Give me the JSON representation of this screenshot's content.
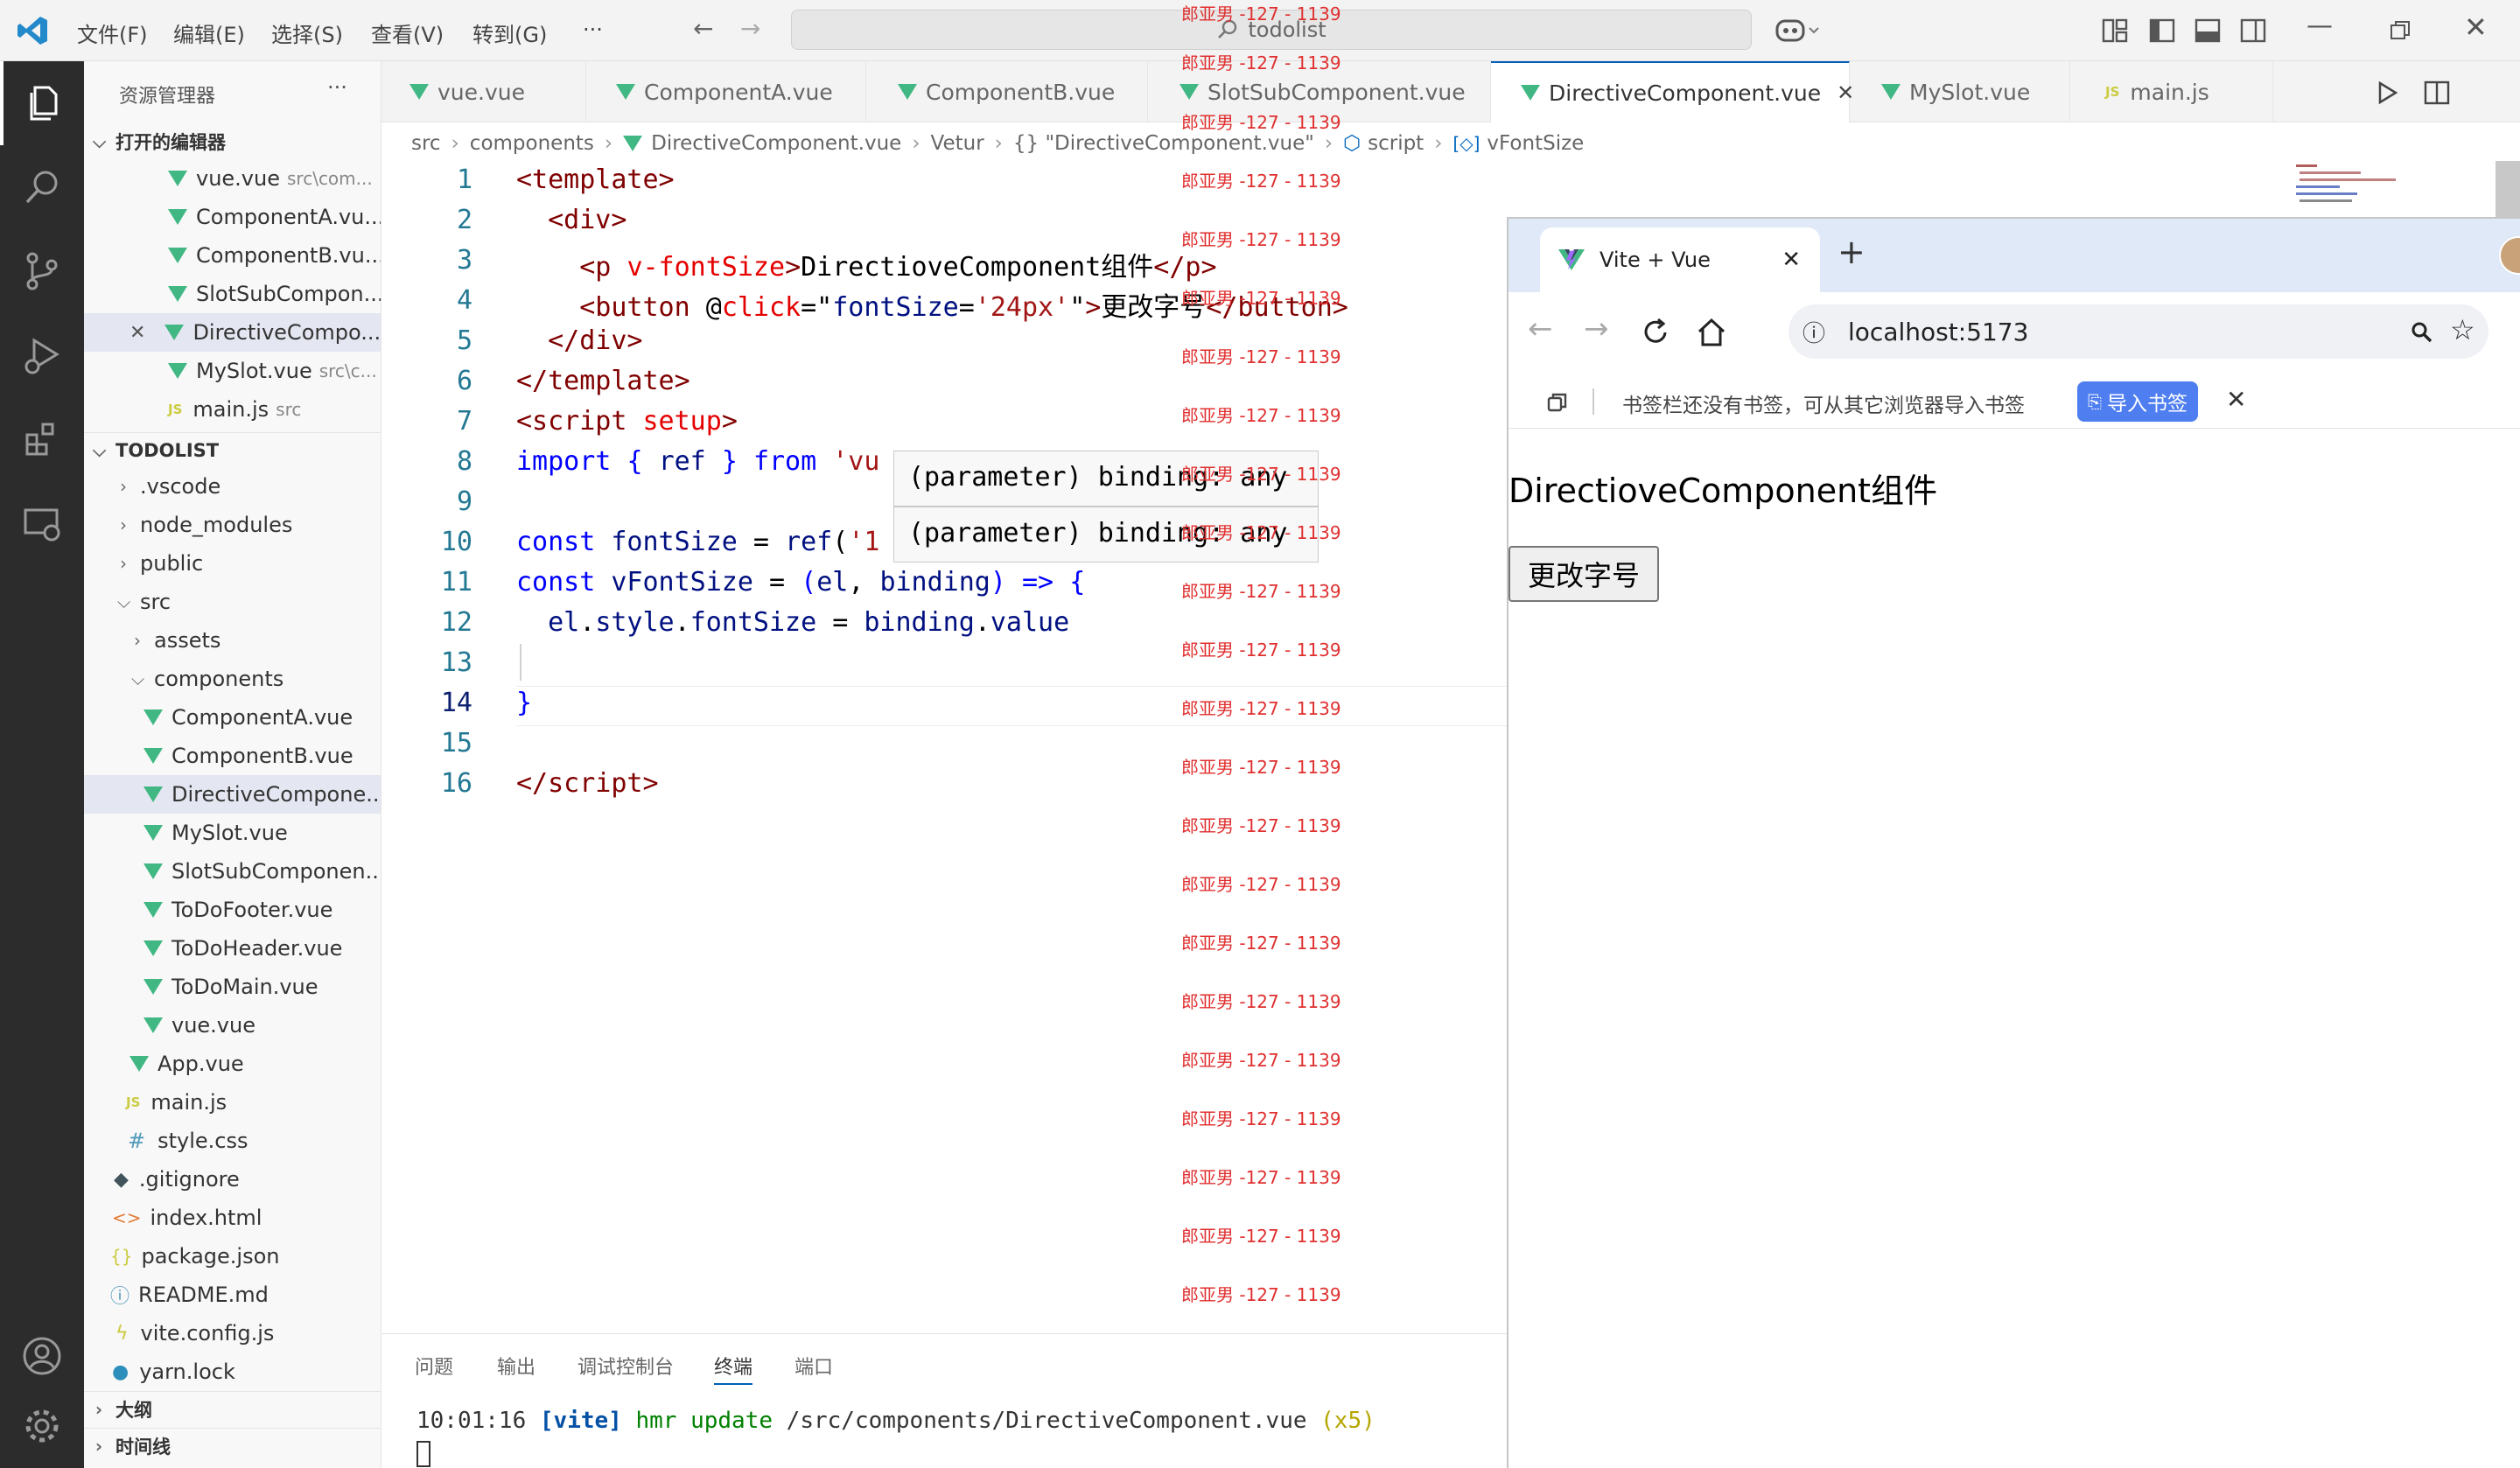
{
  "titlebar": {
    "menu": [
      "文件(F)",
      "编辑(E)",
      "选择(S)",
      "查看(V)",
      "转到(G)",
      "···"
    ],
    "search_text": "todolist"
  },
  "sidebar": {
    "title": "资源管理器",
    "more": "···",
    "open_editors_title": "打开的编辑器",
    "open_editors": [
      {
        "name": "vue.vue",
        "hint": "src\\com..."
      },
      {
        "name": "ComponentA.vu...",
        "hint": ""
      },
      {
        "name": "ComponentB.vu...",
        "hint": ""
      },
      {
        "name": "SlotSubCompon...",
        "hint": ""
      },
      {
        "name": "DirectiveCompo...",
        "hint": ""
      },
      {
        "name": "MySlot.vue",
        "hint": "src\\c..."
      },
      {
        "name": "main.js",
        "hint": "src"
      }
    ],
    "project_title": "TODOLIST",
    "tree": [
      {
        "name": ".vscode"
      },
      {
        "name": "node_modules"
      },
      {
        "name": "public"
      },
      {
        "name": "src"
      },
      {
        "name": "assets"
      },
      {
        "name": "components"
      },
      {
        "name": "ComponentA.vue"
      },
      {
        "name": "ComponentB.vue"
      },
      {
        "name": "DirectiveCompone..."
      },
      {
        "name": "MySlot.vue"
      },
      {
        "name": "SlotSubComponen..."
      },
      {
        "name": "ToDoFooter.vue"
      },
      {
        "name": "ToDoHeader.vue"
      },
      {
        "name": "ToDoMain.vue"
      },
      {
        "name": "vue.vue"
      },
      {
        "name": "App.vue"
      },
      {
        "name": "main.js"
      },
      {
        "name": "style.css"
      },
      {
        "name": ".gitignore"
      },
      {
        "name": "index.html"
      },
      {
        "name": "package.json"
      },
      {
        "name": "README.md"
      },
      {
        "name": "vite.config.js"
      },
      {
        "name": "yarn.lock"
      }
    ],
    "outline_title": "大纲",
    "timeline_title": "时间线"
  },
  "tabs": [
    {
      "label": "vue.vue"
    },
    {
      "label": "ComponentA.vue"
    },
    {
      "label": "ComponentB.vue"
    },
    {
      "label": "SlotSubComponent.vue"
    },
    {
      "label": "DirectiveComponent.vue"
    },
    {
      "label": "MySlot.vue"
    },
    {
      "label": "main.js"
    }
  ],
  "breadcrumb": [
    "src",
    "components",
    "DirectiveComponent.vue",
    "Vetur",
    "{} \"DirectiveComponent.vue\"",
    "script",
    "vFontSize"
  ],
  "editor": {
    "line_numbers": [
      "1",
      "2",
      "3",
      "4",
      "5",
      "6",
      "7",
      "8",
      "9",
      "10",
      "11",
      "12",
      "13",
      "14",
      "15",
      "16"
    ],
    "tooltip": "(parameter) binding: any",
    "watermark": "郎亚男 -127 - 1139"
  },
  "panel": {
    "tabs": [
      "问题",
      "输出",
      "调试控制台",
      "终端",
      "端口"
    ],
    "terminal_time": "10:01:16",
    "terminal_tag": "[vite]",
    "terminal_msg": "hmr update",
    "terminal_path": "/src/components/DirectiveComponent.vue",
    "terminal_count": "(x5)"
  },
  "browser": {
    "tab_title": "Vite + Vue",
    "url": "localhost:5173",
    "bookmarks_text": "书签栏还没有书签，可从其它浏览器导入书签",
    "import_button": "导入书签",
    "page_heading": "DirectioveComponent组件",
    "page_button": "更改字号"
  }
}
